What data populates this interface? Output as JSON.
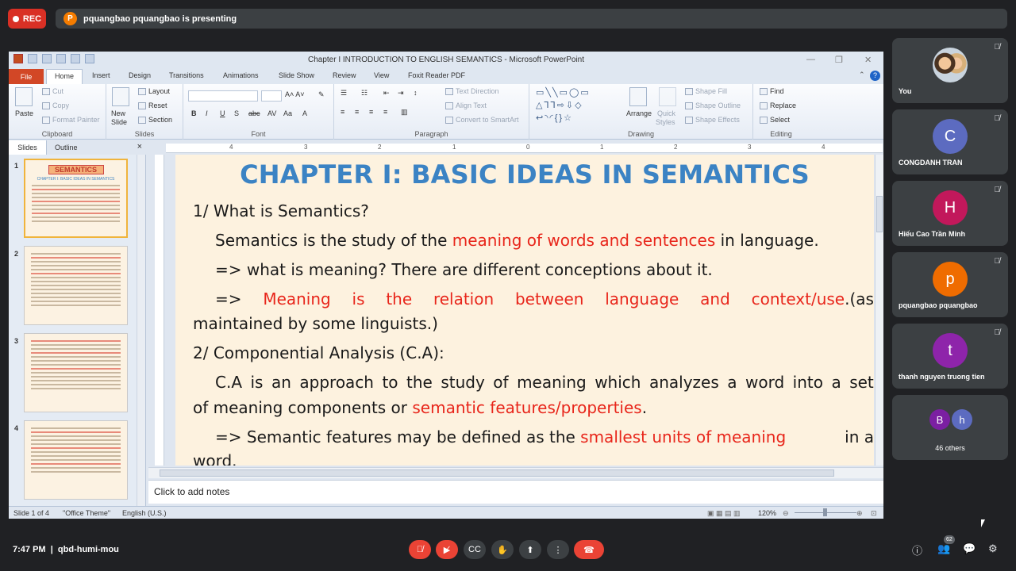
{
  "meet": {
    "rec_label": "REC",
    "presenter_initial": "P",
    "presenting_text": "pquangbao pquangbao is presenting",
    "time": "7:47 PM",
    "separator": "|",
    "meeting_code": "qbd-humi-mou",
    "participant_badge": "62",
    "participants": [
      {
        "name": "You",
        "initial": "",
        "color": ""
      },
      {
        "name": "CONGDANH TRAN",
        "initial": "C",
        "color": "#5c6bc0"
      },
      {
        "name": "Hiếu Cao Trần Minh",
        "initial": "H",
        "color": "#c2185b"
      },
      {
        "name": "pquangbao pquangbao",
        "initial": "p",
        "color": "#ef6c00"
      },
      {
        "name": "thanh nguyen truong tien",
        "initial": "t",
        "color": "#8e24aa"
      }
    ],
    "others": {
      "label": "46 others",
      "initials": [
        "B",
        "h"
      ],
      "colors": [
        "#7b1fa2",
        "#5c6bc0"
      ]
    }
  },
  "ppt": {
    "window_title": "Chapter I INTRODUCTION TO ENGLISH SEMANTICS  -  Microsoft PowerPoint",
    "tabs": [
      "File",
      "Home",
      "Insert",
      "Design",
      "Transitions",
      "Animations",
      "Slide Show",
      "Review",
      "View",
      "Foxit Reader PDF"
    ],
    "ribbon": {
      "clipboard": {
        "paste": "Paste",
        "cut": "Cut",
        "copy": "Copy",
        "format_painter": "Format Painter",
        "name": "Clipboard"
      },
      "slides": {
        "new_slide": "New",
        "new_slide2": "Slide",
        "layout": "Layout",
        "reset": "Reset",
        "section": "Section",
        "name": "Slides"
      },
      "font": {
        "name": "Font"
      },
      "paragraph": {
        "text_direction": "Text Direction",
        "align_text": "Align Text",
        "smartart": "Convert to SmartArt",
        "name": "Paragraph"
      },
      "drawing": {
        "arrange": "Arrange",
        "quick": "Quick",
        "styles": "Styles",
        "shape_fill": "Shape Fill",
        "shape_outline": "Shape Outline",
        "shape_effects": "Shape Effects",
        "name": "Drawing"
      },
      "editing": {
        "find": "Find",
        "replace": "Replace",
        "select": "Select",
        "name": "Editing"
      }
    },
    "left_pane": {
      "tab_slides": "Slides",
      "tab_outline": "Outline",
      "close": "×",
      "thumb_title": "SEMANTICS",
      "thumb_subtitle": "CHAPTER I: BASIC IDEAS IN SEMANTICS",
      "slide_numbers": [
        "1",
        "2",
        "3",
        "4"
      ]
    },
    "ruler_marks": [
      "4",
      "3",
      "2",
      "1",
      "0",
      "1",
      "2",
      "3",
      "4"
    ],
    "slide": {
      "title": "CHAPTER I: BASIC IDEAS IN SEMANTICS",
      "h1": "1/ What is Semantics?",
      "p1_a": "Semantics is the study of the ",
      "p1_b": "meaning of words and sentences",
      "p1_c": " in language.",
      "p2": "=> what is meaning?  There are different conceptions about it.",
      "p3_words": [
        "=>",
        "Meaning",
        "is",
        "the",
        "relation",
        "between",
        "language",
        "and",
        "context/use.(as"
      ],
      "p3_line2": "maintained by some linguists.)",
      "h2": "2/ Componential Analysis (C.A):",
      "p4_line1": [
        "C.A",
        "is",
        "an",
        "approach",
        "to",
        "the",
        "study",
        "of",
        "meaning",
        "which",
        "analyzes",
        "a",
        "word",
        "into",
        "a",
        "set"
      ],
      "p4_line2_a": "of meaning components or ",
      "p4_line2_b": "semantic features/properties",
      "p4_line2_c": ".",
      "p5_a": "=> Semantic features may be defined as the ",
      "p5_b": "smallest units of meaning",
      "p5_c": " in a",
      "p5_line2": "word."
    },
    "notes_placeholder": "Click to add notes",
    "status": {
      "slide_of": "Slide 1 of 4",
      "theme": "\"Office Theme\"",
      "language": "English (U.S.)",
      "zoom": "120%"
    }
  }
}
